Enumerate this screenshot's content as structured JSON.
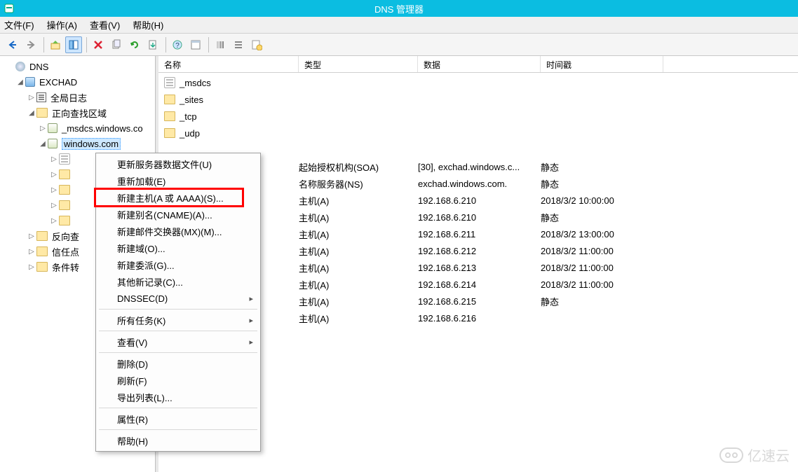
{
  "window": {
    "title": "DNS 管理器"
  },
  "menubar": {
    "file": "文件(F)",
    "action": "操作(A)",
    "view": "查看(V)",
    "help": "帮助(H)"
  },
  "tree": {
    "root": "DNS",
    "server": "EXCHAD",
    "globalLog": "全局日志",
    "fwdZones": "正向查找区域",
    "zone_msdcs": "_msdcs.windows.co",
    "zone_win": "windows.com",
    "sub5a": "",
    "sub5b": "",
    "sub5c": "",
    "sub5d": "",
    "sub5e": "",
    "revZones": "反向查",
    "trustPoints": "信任点",
    "condFwd": "条件转"
  },
  "columns": {
    "name": "名称",
    "type": "类型",
    "data": "数据",
    "timestamp": "时间戳"
  },
  "records": {
    "folders": [
      {
        "name": "_msdcs"
      },
      {
        "name": "_sites"
      },
      {
        "name": "_tcp"
      },
      {
        "name": "_udp"
      }
    ],
    "items": [
      {
        "name": "",
        "type": "",
        "data": "",
        "ts": ""
      },
      {
        "name": "",
        "type": "起始授权机构(SOA)",
        "data": "[30], exchad.windows.c...",
        "ts": "静态"
      },
      {
        "name": "",
        "type": "名称服务器(NS)",
        "data": "exchad.windows.com.",
        "ts": "静态"
      },
      {
        "name": "",
        "type": "主机(A)",
        "data": "192.168.6.210",
        "ts": "2018/3/2 10:00:00"
      },
      {
        "name": "",
        "type": "主机(A)",
        "data": "192.168.6.210",
        "ts": "静态"
      },
      {
        "name": "",
        "type": "主机(A)",
        "data": "192.168.6.211",
        "ts": "2018/3/2 13:00:00"
      },
      {
        "name": "",
        "type": "主机(A)",
        "data": "192.168.6.212",
        "ts": "2018/3/2 11:00:00"
      },
      {
        "name": "",
        "type": "主机(A)",
        "data": "192.168.6.213",
        "ts": "2018/3/2 11:00:00"
      },
      {
        "name": "",
        "type": "主机(A)",
        "data": "192.168.6.214",
        "ts": "2018/3/2 11:00:00"
      },
      {
        "name": "",
        "type": "主机(A)",
        "data": "192.168.6.215",
        "ts": "静态"
      },
      {
        "name": "",
        "type": "主机(A)",
        "data": "192.168.6.216",
        "ts": ""
      }
    ]
  },
  "contextMenu": {
    "updateDataFile": "更新服务器数据文件(U)",
    "reload": "重新加载(E)",
    "newHost": "新建主机(A 或 AAAA)(S)...",
    "newAlias": "新建别名(CNAME)(A)...",
    "newMX": "新建邮件交换器(MX)(M)...",
    "newDomain": "新建域(O)...",
    "newDelegation": "新建委派(G)...",
    "otherNew": "其他新记录(C)...",
    "dnssec": "DNSSEC(D)",
    "allTasks": "所有任务(K)",
    "view": "查看(V)",
    "delete": "删除(D)",
    "refresh": "刷新(F)",
    "exportList": "导出列表(L)...",
    "properties": "属性(R)",
    "help": "帮助(H)"
  },
  "watermark": {
    "text": "亿速云"
  }
}
